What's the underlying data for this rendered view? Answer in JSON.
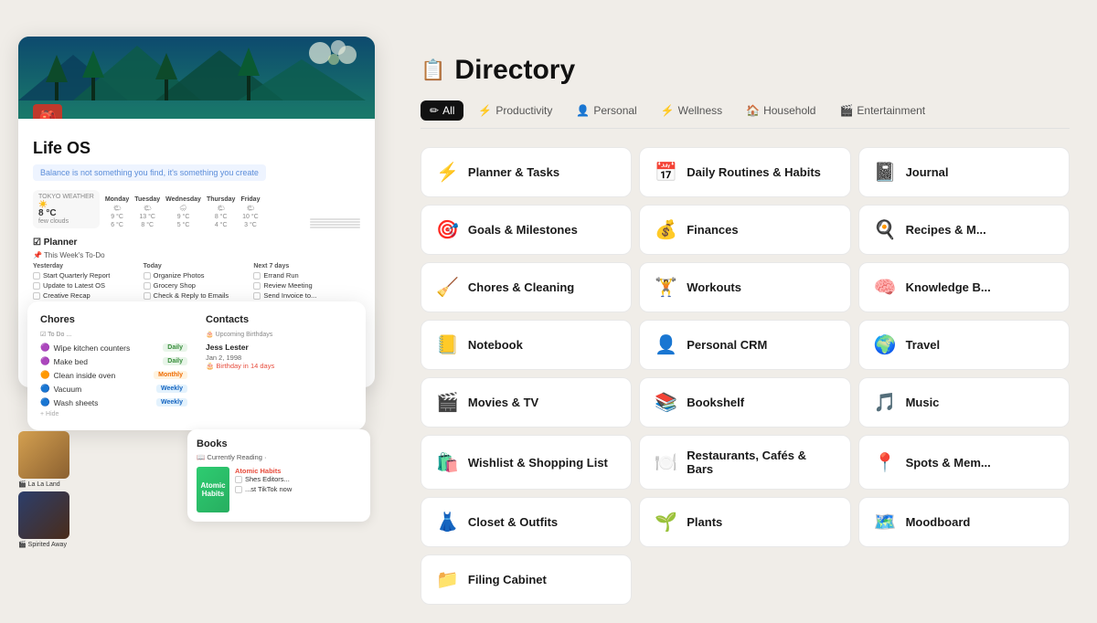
{
  "app": {
    "title": "Life OS"
  },
  "left": {
    "quote": "Balance is not something you find, it's something you create",
    "weather": {
      "location": "TOKYO WEATHER",
      "temp": "8 °C",
      "condition": "few clouds"
    },
    "days": [
      {
        "name": "Monday",
        "icon": "🌤",
        "high": "9 °C",
        "low": "6 °C"
      },
      {
        "name": "Tuesday",
        "icon": "🌤",
        "high": "13 °C",
        "low": "8 °C"
      },
      {
        "name": "Wednesday",
        "icon": "🌧",
        "high": "9 °C",
        "low": "5 °C"
      },
      {
        "name": "Thursday",
        "icon": "🌤",
        "high": "8 °C",
        "low": "4 °C"
      },
      {
        "name": "Friday",
        "icon": "🌤",
        "high": "10 °C",
        "low": "3 °C"
      }
    ],
    "planner": {
      "title": "Planner",
      "subtitle": "This Week's To-Do",
      "columns": [
        {
          "name": "Yesterday",
          "tasks": [
            "Start Quarterly Report",
            "Update to Latest OS",
            "Creative Recap"
          ]
        },
        {
          "name": "Today",
          "tasks": [
            "Organize Photos",
            "Grocery Shop",
            "Check & Reply to Emails"
          ]
        },
        {
          "name": "Next 7 days",
          "tasks": [
            "Errand Run",
            "Review Meeting",
            "Send Invoice to..."
          ]
        }
      ]
    },
    "chores": {
      "title": "Chores",
      "subtitle": "To Do ...",
      "items": [
        {
          "label": "Wipe kitchen counters",
          "badge": "Daily",
          "type": "daily"
        },
        {
          "label": "Make bed",
          "badge": "Daily",
          "type": "daily"
        },
        {
          "label": "Clean inside oven",
          "badge": "Monthly",
          "type": "monthly"
        },
        {
          "label": "Vacuum",
          "badge": "Weekly",
          "type": "weekly"
        },
        {
          "label": "Wash sheets",
          "badge": "Weekly",
          "type": "weekly"
        }
      ]
    },
    "contacts": {
      "title": "Contacts",
      "subtitle": "Upcoming Birthdays",
      "items": [
        {
          "name": "Jess Lester",
          "date": "Jan 2, 1998",
          "note": "Birthday in 14 days"
        }
      ]
    },
    "movies": [
      {
        "title": "La La Land",
        "color": "#8b6f47"
      },
      {
        "title": "Spirited Away",
        "color": "#2c3e6b"
      }
    ]
  },
  "directory": {
    "icon": "📋",
    "title": "Directory",
    "tabs": [
      {
        "label": "All",
        "icon": "✏",
        "active": true
      },
      {
        "label": "Productivity",
        "icon": "⚡"
      },
      {
        "label": "Personal",
        "icon": "👤"
      },
      {
        "label": "Wellness",
        "icon": "⚡"
      },
      {
        "label": "Household",
        "icon": "🏠"
      },
      {
        "label": "Entertainment",
        "icon": "🎬"
      }
    ],
    "items": [
      {
        "icon": "⚡",
        "label": "Planner & Tasks"
      },
      {
        "icon": "📅",
        "label": "Daily Routines & Habits"
      },
      {
        "icon": "📓",
        "label": "Journal"
      },
      {
        "icon": "🎯",
        "label": "Goals & Milestones"
      },
      {
        "icon": "💰",
        "label": "Finances"
      },
      {
        "icon": "🍳",
        "label": "Recipes & M..."
      },
      {
        "icon": "🧹",
        "label": "Chores & Cleaning"
      },
      {
        "icon": "🏋️",
        "label": "Workouts"
      },
      {
        "icon": "🧠",
        "label": "Knowledge B..."
      },
      {
        "icon": "📒",
        "label": "Notebook"
      },
      {
        "icon": "👤",
        "label": "Personal CRM"
      },
      {
        "icon": "🌍",
        "label": "Travel"
      },
      {
        "icon": "🎬",
        "label": "Movies & TV"
      },
      {
        "icon": "📚",
        "label": "Bookshelf"
      },
      {
        "icon": "🎵",
        "label": "Music"
      },
      {
        "icon": "🛍️",
        "label": "Wishlist & Shopping List"
      },
      {
        "icon": "🍽️",
        "label": "Restaurants, Cafés & Bars"
      },
      {
        "icon": "📍",
        "label": "Spots & Mem..."
      },
      {
        "icon": "👗",
        "label": "Closet & Outfits"
      },
      {
        "icon": "🌱",
        "label": "Plants"
      },
      {
        "icon": "🗺️",
        "label": "Moodboard"
      },
      {
        "icon": "📁",
        "label": "Filing Cabinet"
      }
    ]
  }
}
